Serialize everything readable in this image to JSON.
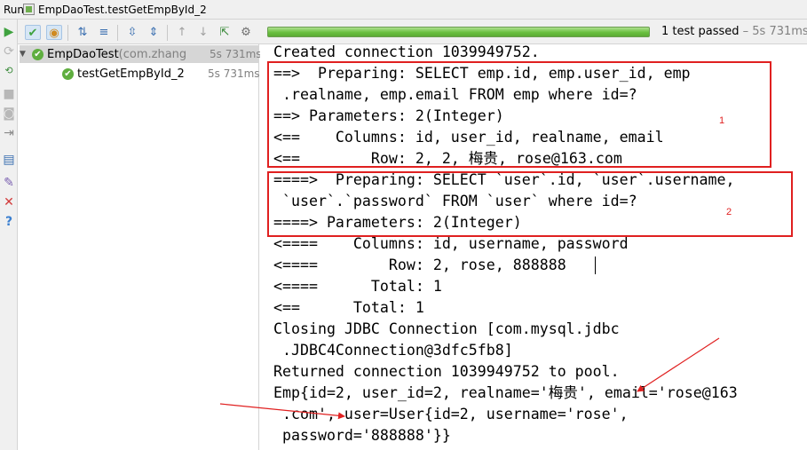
{
  "title_bar": {
    "run_label": "Run",
    "tab_title": "EmpDaoTest.testGetEmpById_2"
  },
  "toolbar": {
    "status_main": "1 test passed",
    "status_time": " – 5s 731ms",
    "progress": 1.0,
    "progress_color": "#6ac040"
  },
  "tree": {
    "root": {
      "name": "EmpDaoTest",
      "pkg": " (com.zhang",
      "time": "5s 731ms"
    },
    "child": {
      "name": "testGetEmpById_2",
      "time": "5s 731ms"
    }
  },
  "console": {
    "lines": [
      "Created connection 1039949752.",
      "==>  Preparing: SELECT emp.id, emp.user_id, emp",
      " .realname, emp.email FROM emp where id=?",
      "==> Parameters: 2(Integer)",
      "<==    Columns: id, user_id, realname, email",
      "<==        Row: 2, 2, 梅贵, rose@163.com",
      "====>  Preparing: SELECT `user`.id, `user`.username,",
      " `user`.`password` FROM `user` where id=?",
      "====> Parameters: 2(Integer)",
      "<====    Columns: id, username, password",
      "<====        Row: 2, rose, 888888",
      "<====      Total: 1",
      "<==      Total: 1",
      "Closing JDBC Connection [com.mysql.jdbc",
      " .JDBC4Connection@3dfc5fb8]",
      "Returned connection 1039949752 to pool.",
      "Emp{id=2, user_id=2, realname='梅贵', email='rose@163",
      " .com', user=User{id=2, username='rose',",
      " password='888888'}}"
    ],
    "annotations": [
      "1",
      "2"
    ],
    "annotation_color": "#e02020"
  }
}
